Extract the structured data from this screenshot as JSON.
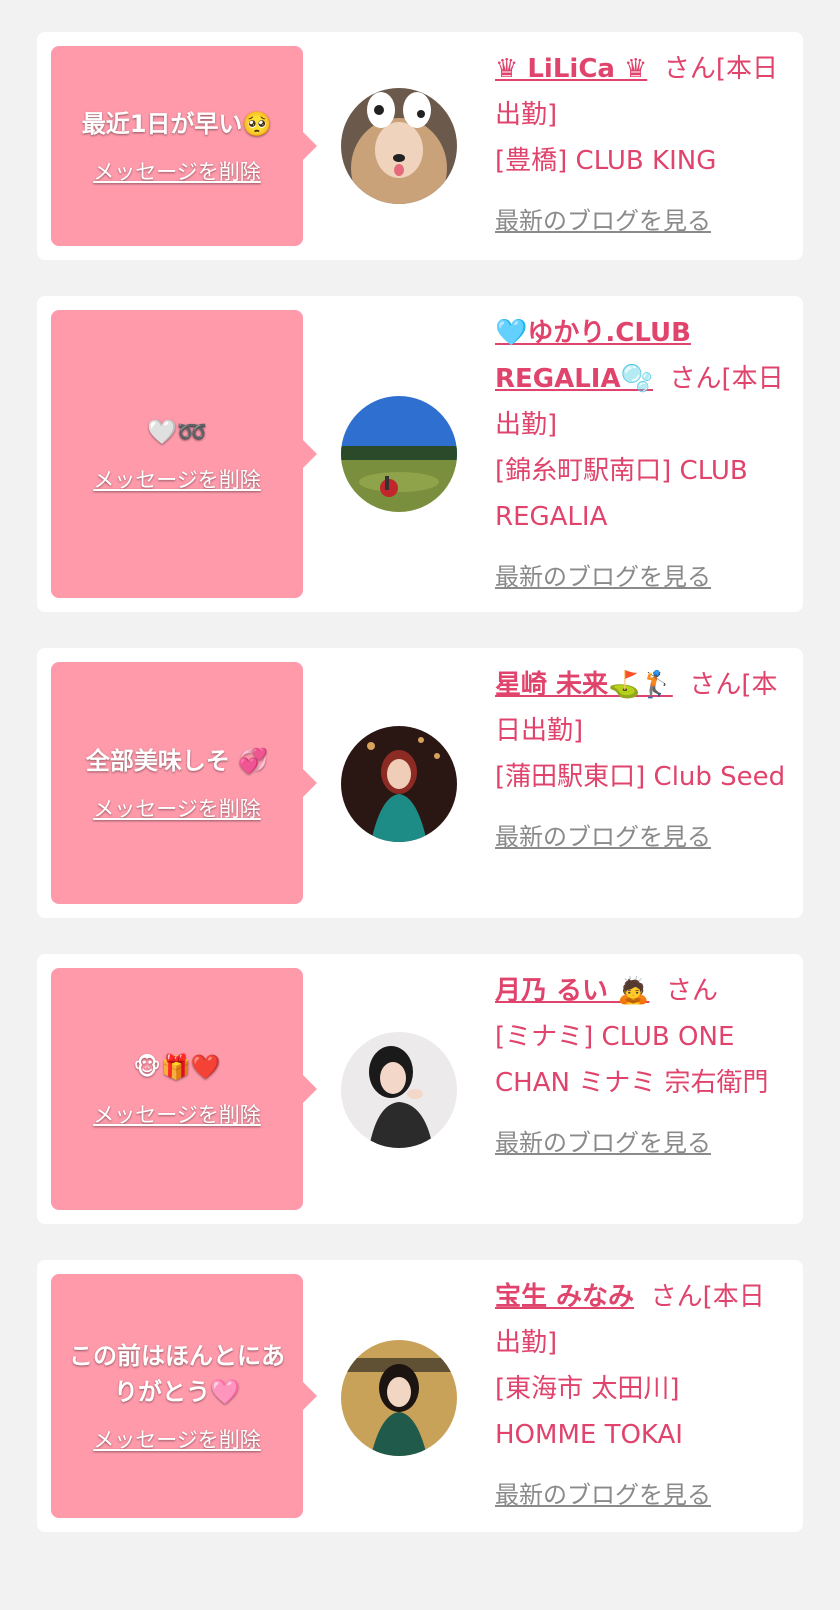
{
  "cards": [
    {
      "message": "最近1日が早い🥺",
      "delete_label": "メッセージを削除",
      "name": "♛ LiLiCa ♛",
      "honorific_status": "さん[本日出勤]",
      "location": "[豊橋] CLUB KING",
      "blog_label": "最新のブログを見る",
      "avatar": "girl-with-dog-filter"
    },
    {
      "message": "🤍➿",
      "delete_label": "メッセージを削除",
      "name": "🩵ゆかり.CLUB REGALIA🫧",
      "honorific_status": "さん[本日出勤]",
      "location": "[錦糸町駅南口] CLUB REGALIA",
      "blog_label": "最新のブログを見る",
      "avatar": "golf-course"
    },
    {
      "message": "全部美味しそ 💞",
      "delete_label": "メッセージを削除",
      "name": "星崎 未来⛳🏌",
      "honorific_status": "さん[本日出勤]",
      "location": "[蒲田駅東口] Club Seed",
      "blog_label": "最新のブログを見る",
      "avatar": "woman-green-dress"
    },
    {
      "message": "🐵🎁❤️",
      "delete_label": "メッセージを削除",
      "name": "月乃 るい 🙇",
      "honorific_status": "さん",
      "location": "[ミナミ] CLUB ONE CHAN ミナミ 宗右衛門",
      "blog_label": "最新のブログを見る",
      "avatar": "woman-black-dress"
    },
    {
      "message": "この前はほんとにありがとう🩷",
      "delete_label": "メッセージを削除",
      "name": "宝生 みなみ",
      "honorific_status": "さん[本日出勤]",
      "location": "[東海市 太田川] HOMME TOKAI",
      "blog_label": "最新のブログを見る",
      "avatar": "woman-homme-sign"
    }
  ],
  "colors": {
    "bubble": "#ff9aab",
    "accent": "#e0436b",
    "muted_link": "#8a8a8a",
    "background": "#f2f2f2"
  }
}
